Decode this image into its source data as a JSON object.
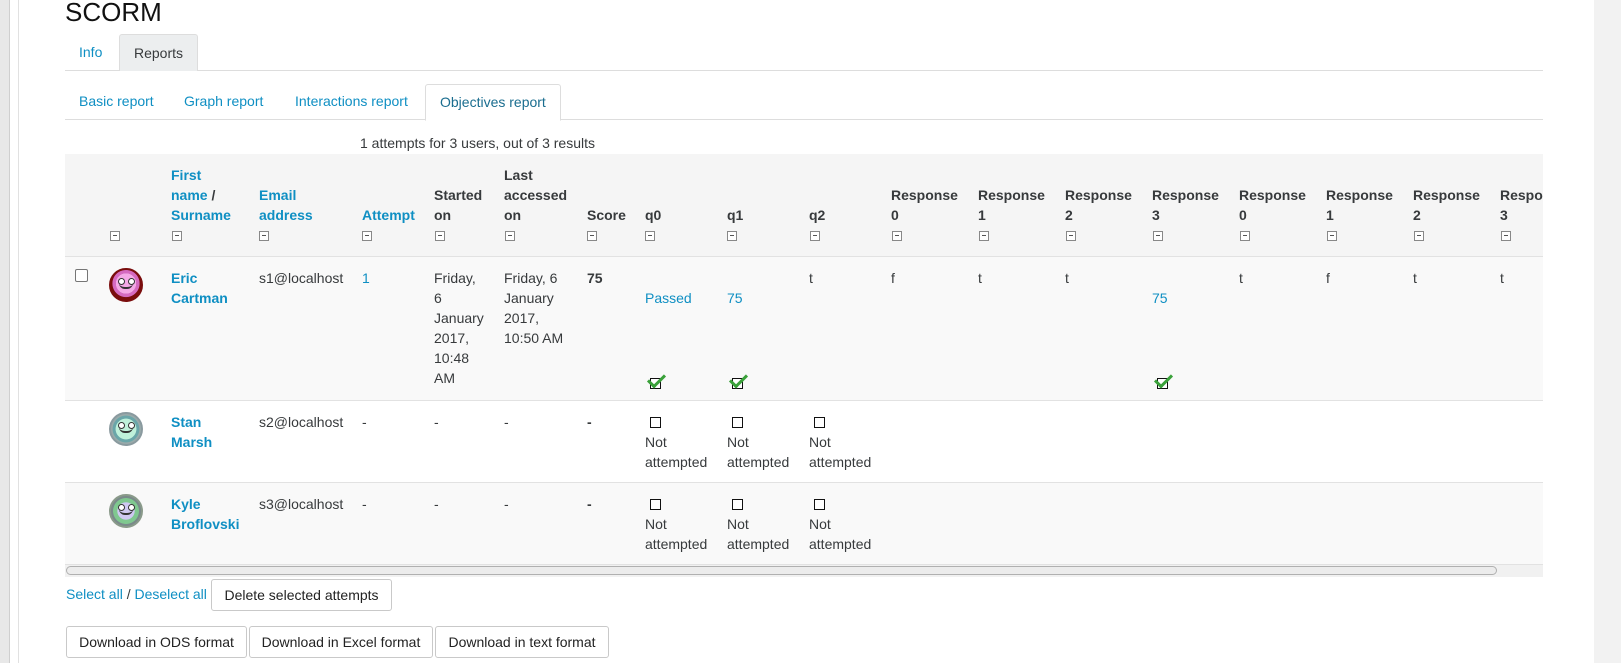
{
  "page": {
    "title": "SCORM"
  },
  "tabs": [
    {
      "label": "Info"
    },
    {
      "label": "Reports"
    }
  ],
  "subtabs": [
    {
      "label": "Basic report"
    },
    {
      "label": "Graph report"
    },
    {
      "label": "Interactions report"
    },
    {
      "label": "Objectives report"
    }
  ],
  "summary": "1 attempts for 3 users, out of 3 results",
  "table": {
    "headers": {
      "first_name": "First name",
      "slash": "/",
      "surname": "Surname",
      "email": "Email address",
      "attempt": "Attempt",
      "started_on": "Started on",
      "last_accessed_on": "Last accessed on",
      "score": "Score",
      "q0": "q0",
      "q1": "q1",
      "q2": "q2",
      "responses": [
        "Response 0",
        "Response 1",
        "Response 2",
        "Response 3",
        "Response 0",
        "Response 1",
        "Response 2",
        "Respo 3"
      ]
    },
    "rows": [
      {
        "name_first": "Eric",
        "name_last": "Cartman",
        "email": "s1@localhost",
        "attempt": "1",
        "started": [
          "Friday,",
          "6",
          "January",
          "2017,",
          "10:48",
          "AM"
        ],
        "last": [
          "Friday, 6",
          "January",
          "2017,",
          "10:50 AM"
        ],
        "score": "75",
        "q0": "Passed",
        "q1": "75",
        "q2": "t",
        "responses": [
          "f",
          "t",
          "t",
          "75",
          "t",
          "f",
          "t",
          "t"
        ]
      },
      {
        "name_first": "Stan",
        "name_last": "Marsh",
        "email": "s2@localhost",
        "attempt": "-",
        "started": "-",
        "last": "-",
        "score": "-",
        "q0": [
          "Not",
          "attempted"
        ],
        "q1": [
          "Not",
          "attempted"
        ],
        "q2": [
          "Not",
          "attempted"
        ]
      },
      {
        "name_first": "Kyle",
        "name_last": "Broflovski",
        "email": "s3@localhost",
        "attempt": "-",
        "started": "-",
        "last": "-",
        "score": "-",
        "q0": [
          "Not",
          "attempted"
        ],
        "q1": [
          "Not",
          "attempted"
        ],
        "q2": [
          "Not",
          "attempted"
        ]
      }
    ]
  },
  "actions": {
    "select_all": "Select all",
    "separator": "/",
    "deselect_all": "Deselect all",
    "delete": "Delete selected attempts"
  },
  "downloads": [
    "Download in ODS format",
    "Download in Excel format",
    "Download in text format"
  ]
}
